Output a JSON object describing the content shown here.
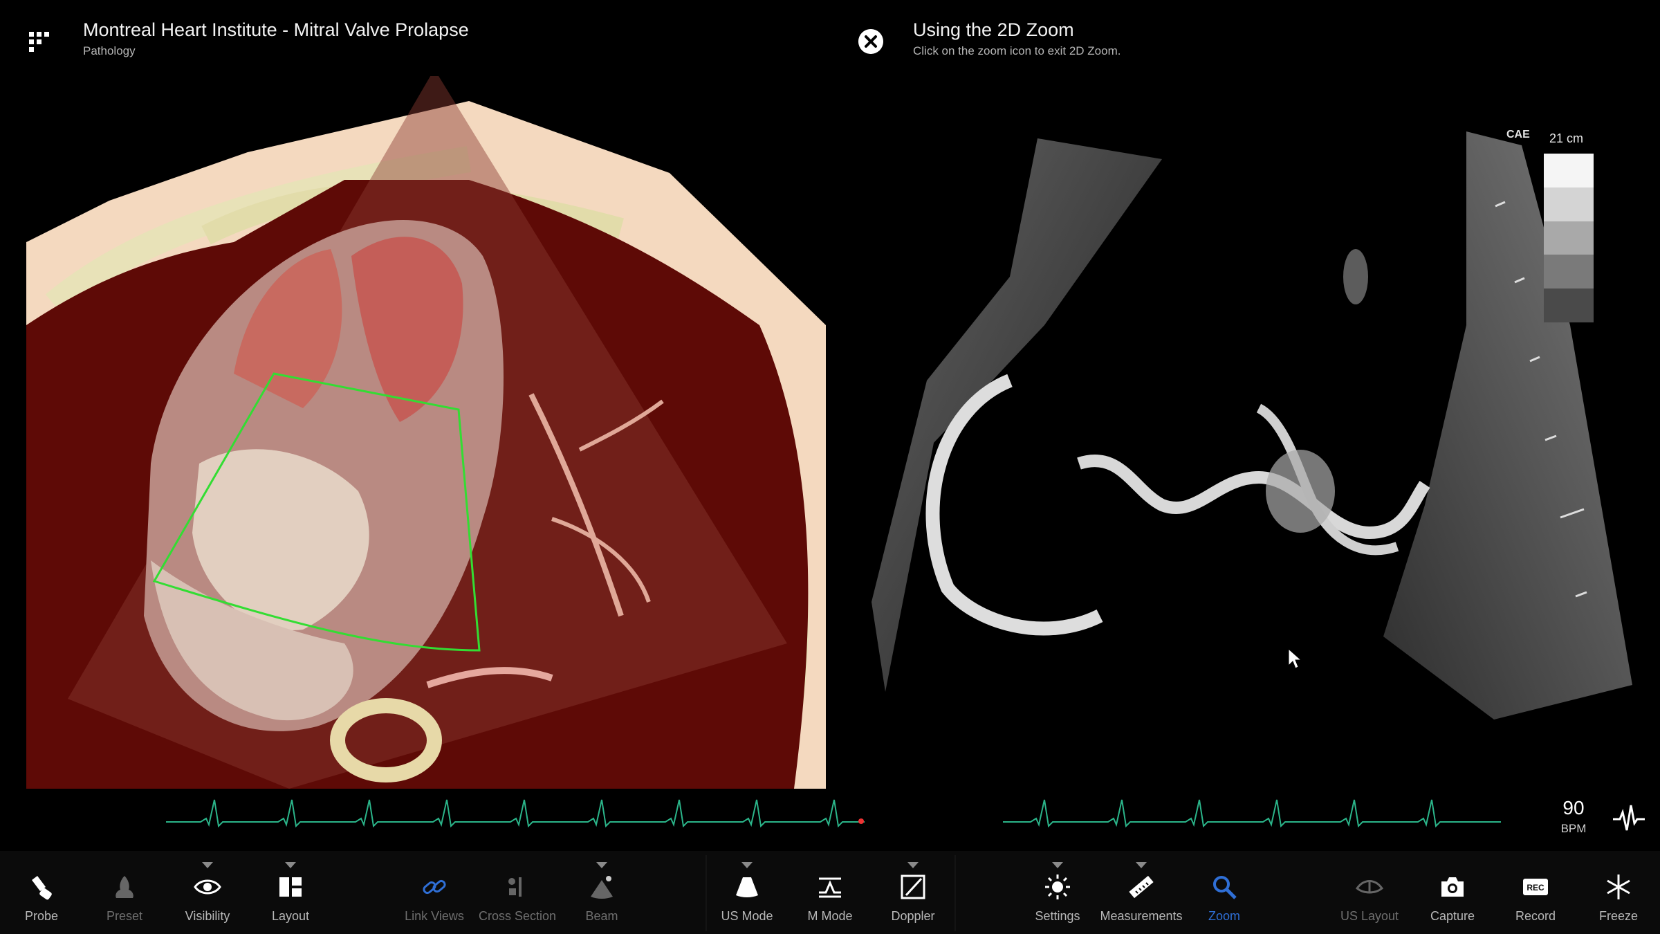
{
  "header": {
    "title": "Montreal Heart Institute - Mitral Valve Prolapse",
    "subtitle": "Pathology"
  },
  "hint": {
    "title": "Using the 2D Zoom",
    "text": "Click on the zoom icon to exit 2D Zoom."
  },
  "ultrasound": {
    "depth": "21 cm",
    "logo": "CAE",
    "bpm": "90",
    "bpm_unit": "BPM"
  },
  "toolbar": {
    "probe": "Probe",
    "preset": "Preset",
    "visibility": "Visibility",
    "layout": "Layout",
    "link_views": "Link Views",
    "cross_section": "Cross Section",
    "beam": "Beam",
    "us_mode": "US Mode",
    "m_mode": "M Mode",
    "doppler": "Doppler",
    "settings": "Settings",
    "measurements": "Measurements",
    "zoom": "Zoom",
    "us_layout": "US Layout",
    "capture": "Capture",
    "record": "Record",
    "freeze": "Freeze"
  },
  "colors": {
    "accent_blue": "#2f6fd6",
    "ecg_green": "#2bb58a",
    "sector_green": "#33dd33"
  }
}
